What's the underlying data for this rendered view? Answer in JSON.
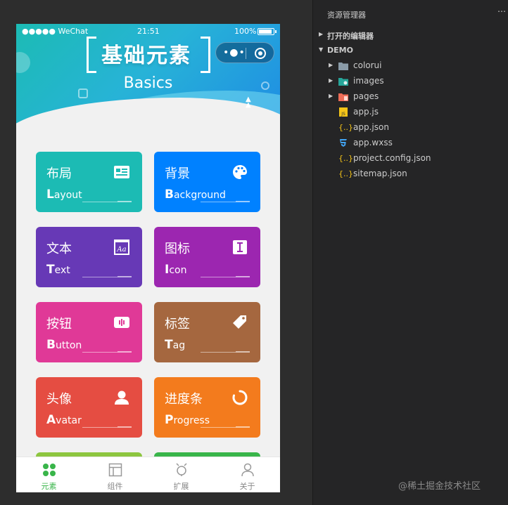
{
  "statusbar": {
    "carrier": "●●●●● WeChat",
    "time": "21:51",
    "battery": "100%"
  },
  "banner": {
    "title": "基础元素",
    "subtitle": "Basics"
  },
  "cards": [
    {
      "cn": "布局",
      "initial": "L",
      "rest": "ayout",
      "color": "#1cbbb4",
      "icon": "id-card-icon"
    },
    {
      "cn": "背景",
      "initial": "B",
      "rest": "ackground",
      "color": "#0081ff",
      "icon": "palette-icon"
    },
    {
      "cn": "文本",
      "initial": "T",
      "rest": "ext",
      "color": "#6739b6",
      "icon": "text-aa-icon"
    },
    {
      "cn": "图标",
      "initial": "I",
      "rest": "con",
      "color": "#9c26b0",
      "icon": "text-cursor-icon"
    },
    {
      "cn": "按钮",
      "initial": "B",
      "rest": "utton",
      "color": "#e03997",
      "icon": "button-icon"
    },
    {
      "cn": "标签",
      "initial": "T",
      "rest": "ag",
      "color": "#a5673f",
      "icon": "tag-icon"
    },
    {
      "cn": "头像",
      "initial": "A",
      "rest": "vatar",
      "color": "#e54d42",
      "icon": "person-icon"
    },
    {
      "cn": "进度条",
      "initial": "P",
      "rest": "rogress",
      "color": "#f37b1d",
      "icon": "loading-icon"
    }
  ],
  "tabs": [
    {
      "label": "元素",
      "icon": "elements-icon",
      "active": true
    },
    {
      "label": "组件",
      "icon": "components-icon",
      "active": false
    },
    {
      "label": "扩展",
      "icon": "plugin-icon",
      "active": false
    },
    {
      "label": "关于",
      "icon": "profile-icon",
      "active": false
    }
  ],
  "explorer": {
    "title": "资源管理器",
    "open_editors": "打开的编辑器",
    "project": "DEMO",
    "items": [
      {
        "name": "colorui",
        "type": "folder"
      },
      {
        "name": "images",
        "type": "folder"
      },
      {
        "name": "pages",
        "type": "folder"
      },
      {
        "name": "app.js",
        "type": "js"
      },
      {
        "name": "app.json",
        "type": "json"
      },
      {
        "name": "app.wxss",
        "type": "wxss"
      },
      {
        "name": "project.config.json",
        "type": "json"
      },
      {
        "name": "sitemap.json",
        "type": "json"
      }
    ]
  },
  "watermark": "@稀土掘金技术社区"
}
